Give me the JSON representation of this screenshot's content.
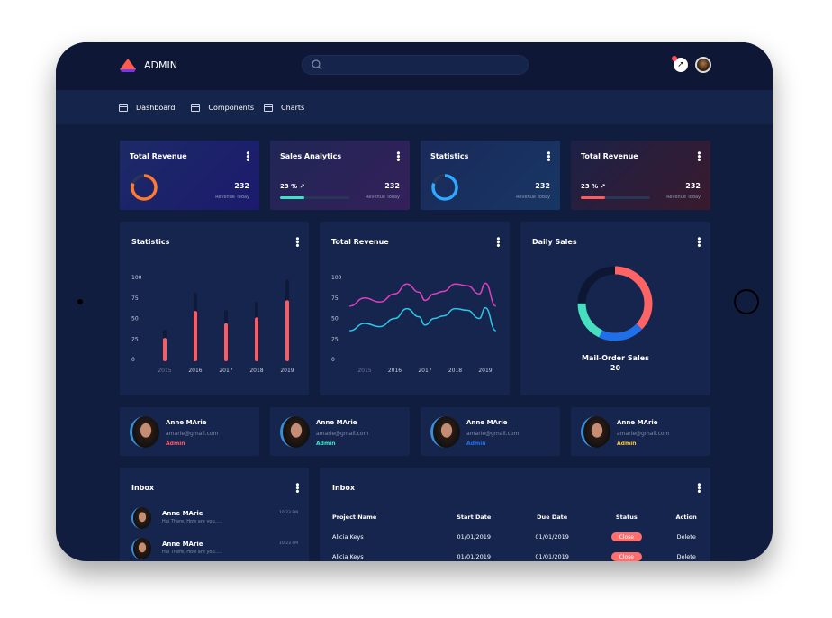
{
  "header": {
    "app_name": "ADMIN",
    "search_placeholder": ""
  },
  "nav": [
    {
      "label": "Dashboard"
    },
    {
      "label": "Components"
    },
    {
      "label": "Charts"
    }
  ],
  "stat_cards": [
    {
      "title": "Total Revenue",
      "value": "232",
      "caption": "Revenue Today",
      "ring_color": "#ff7a2f",
      "ring_fraction": 0.8
    },
    {
      "title": "Sales Analytics",
      "percent": "23 %",
      "value": "232",
      "caption": "Revenue Today",
      "bar_color": "#3fe0c5",
      "bar_fraction": 0.35
    },
    {
      "title": "Statistics",
      "value": "232",
      "caption": "Revenue Today",
      "ring_color": "#2ea9ff",
      "ring_fraction": 0.8
    },
    {
      "title": "Total Revenue",
      "percent": "23 %",
      "value": "232",
      "caption": "Revenue Today",
      "bar_color": "#ff5a5f",
      "bar_fraction": 0.35
    }
  ],
  "chart_data": [
    {
      "type": "bar",
      "title": "Statistics",
      "categories": [
        "2015",
        "2016",
        "2017",
        "2018",
        "2019"
      ],
      "values": [
        24,
        57,
        42,
        49,
        70
      ],
      "background_values": [
        34,
        79,
        58,
        68,
        95
      ],
      "yticks": [
        "0",
        "25",
        "50",
        "75",
        "100"
      ],
      "ylim": [
        0,
        100
      ],
      "color": "#ff5a5f"
    },
    {
      "type": "line",
      "title": "Total Revenue",
      "categories": [
        "2015",
        "2016",
        "2017",
        "2018",
        "2019"
      ],
      "yticks": [
        "0",
        "25",
        "50",
        "75",
        "100"
      ],
      "ylim": [
        0,
        100
      ],
      "x": [
        2014.5,
        2015,
        2015.5,
        2016,
        2016.4,
        2016.8,
        2017,
        2017.3,
        2017.6,
        2018,
        2018.4,
        2018.8,
        2019,
        2019.35
      ],
      "series": [
        {
          "color": "#e040c0",
          "values": [
            65,
            75,
            70,
            80,
            92,
            82,
            72,
            80,
            83,
            92,
            90,
            80,
            93,
            65
          ]
        },
        {
          "color": "#2ec6e8",
          "values": [
            35,
            44,
            40,
            50,
            62,
            52,
            42,
            50,
            53,
            62,
            60,
            50,
            63,
            35
          ]
        }
      ]
    },
    {
      "type": "pie",
      "title": "Daily Sales",
      "label": "Mail-Order Sales",
      "value": "20",
      "slices": [
        {
          "value": 37,
          "color": "#ff6465"
        },
        {
          "value": 20,
          "color": "#1f6fe8"
        },
        {
          "value": 18,
          "color": "#45e0bf"
        },
        {
          "value": 25,
          "color": "#0d1733"
        }
      ]
    }
  ],
  "users": [
    {
      "name": "Anne MArie",
      "email": "amarie@gmail.com",
      "role": "Admin",
      "role_color": "#ff5a6a"
    },
    {
      "name": "Anne MArie",
      "email": "amarie@gmail.com",
      "role": "Admin",
      "role_color": "#3fe0c5"
    },
    {
      "name": "Anne MArie",
      "email": "amarie@gmail.com",
      "role": "Admin",
      "role_color": "#1f6fe8"
    },
    {
      "name": "Anne MArie",
      "email": "amarie@gmail.com",
      "role": "Admin",
      "role_color": "#f6c343"
    }
  ],
  "inbox": {
    "title": "Inbox",
    "messages": [
      {
        "name": "Anne MArie",
        "text": "Hai There, How are you.....",
        "time": "10:23 PM"
      },
      {
        "name": "Anne MArie",
        "text": "Hai There, How are you.....",
        "time": "10:23 PM"
      }
    ]
  },
  "projects": {
    "title": "Inbox",
    "headers": [
      "Project Name",
      "Start Date",
      "Due Date",
      "Status",
      "Action"
    ],
    "rows": [
      {
        "name": "Alicia Keys",
        "start": "01/01/2019",
        "due": "01/01/2019",
        "status": "Close",
        "action": "Delete"
      },
      {
        "name": "Alicia Keys",
        "start": "01/01/2019",
        "due": "01/01/2019",
        "status": "Close",
        "action": "Delete"
      }
    ]
  }
}
